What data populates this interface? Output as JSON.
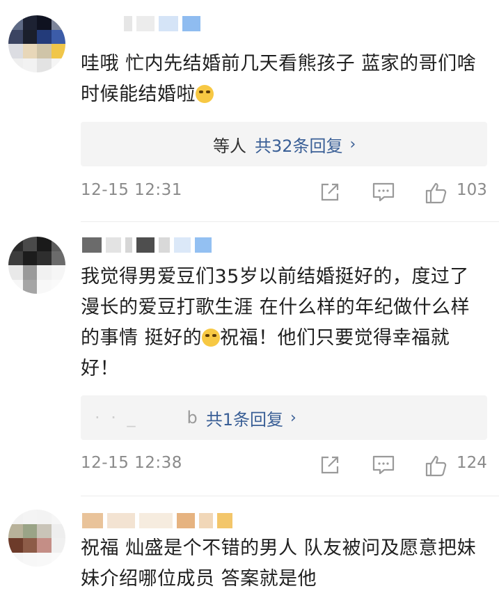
{
  "comments": [
    {
      "text": "哇哦 忙内先结婚前几天看熊孩子 蓝家的哥们啥时候能结婚啦",
      "reply": {
        "who": "等人",
        "count": "共32条回复",
        "arrow": "›"
      },
      "time": "12-15 12:31",
      "likes": "103"
    },
    {
      "text": "我觉得男爱豆们35岁以前结婚挺好的，度过了漫长的爱豆打歌生涯 在什么样的年纪做什么样的事情 挺好的",
      "text_after_emoji": "祝福！他们只要觉得幸福就好！",
      "reply": {
        "who": "b",
        "count": "共1条回复",
        "arrow": "›"
      },
      "time": "12-15 12:38",
      "likes": "124"
    },
    {
      "text": "祝福 灿盛是个不错的男人 队友被问及愿意把妹妹介绍哪位成员 答案就是他"
    }
  ],
  "icons": [
    "share-icon",
    "comment-icon",
    "like-icon",
    "laugh-cry-emoji",
    "grin-emoji"
  ],
  "colors": {
    "link": "#3a5f96",
    "meta": "#8a8a8a",
    "reply_bg": "#f4f4f4"
  }
}
